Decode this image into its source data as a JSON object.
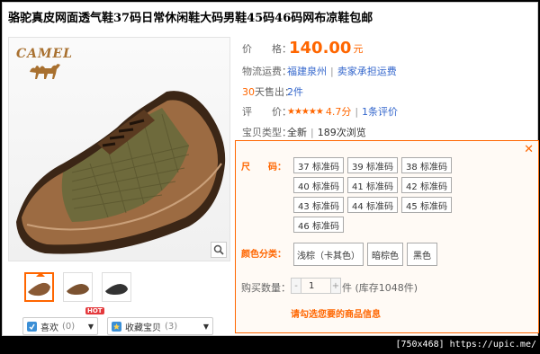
{
  "product": {
    "title": "骆驼真皮网面透气鞋37码日常休闲鞋大码男鞋45码46码网布凉鞋包邮",
    "brand_logo_text": "CAMEL"
  },
  "info": {
    "price_label": "价　　格：",
    "price_value": "140.00",
    "price_unit": "元",
    "shipping_label": "物流运费：",
    "shipping_location": "福建泉州",
    "shipping_sep": "|",
    "shipping_fee": "卖家承担运费",
    "sales_label_num": "30",
    "sales_label_text": "天售出：",
    "sales_value": "2件",
    "rating_label": "评　　价：",
    "rating_stars": "★★★★★",
    "rating_score": "4.7分",
    "rating_sep": "|",
    "rating_count": "1条评价",
    "type_label": "宝贝类型：",
    "type_value": "全新",
    "type_sep": "|",
    "views": "189次浏览"
  },
  "sku": {
    "close": "✕",
    "size_label": "尺　　码：",
    "sizes": [
      "37 标准码",
      "39 标准码",
      "38 标准码",
      "40 标准码",
      "41 标准码",
      "42 标准码",
      "43 标准码",
      "44 标准码",
      "45 标准码",
      "46 标准码"
    ],
    "color_label": "颜色分类：",
    "colors": [
      "浅棕（卡其色）",
      "暗棕色",
      "黑色"
    ],
    "qty_label": "购买数量：",
    "qty_minus": "-",
    "qty_value": "1",
    "qty_plus": "+",
    "stock_text": "件 (库存1048件)",
    "hint": "请勾选您要的商品信息"
  },
  "social": {
    "like_label": "喜欢",
    "like_count": "(0)",
    "hot_badge": "HOT",
    "fav_label": "收藏宝贝",
    "fav_count": "(3)"
  },
  "watermark": "[750x468] https://upic.me/",
  "colors": {
    "accent": "#ff6600",
    "link": "#3366cc"
  }
}
